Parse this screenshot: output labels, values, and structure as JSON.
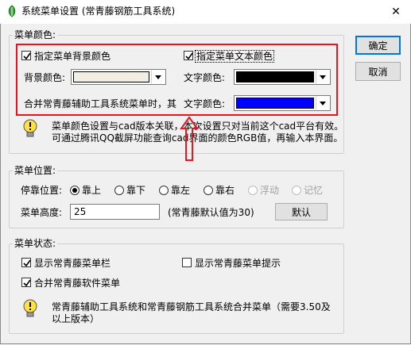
{
  "window": {
    "title": "系统菜单设置 (常青藤钢筋工具系统)",
    "close_glyph": "✕"
  },
  "buttons": {
    "ok": "确定",
    "cancel": "取消",
    "default_value": "默认"
  },
  "menu_color": {
    "legend": "菜单颜色:",
    "bg_checkbox": {
      "label": "指定菜单背景颜色",
      "checked": true
    },
    "text_checkbox": {
      "label": "指定菜单文本颜色",
      "checked": true
    },
    "bg_color_label": "背景颜色:",
    "bg_color_value": "#f2eee4",
    "text_color_label_1": "文字颜色:",
    "text_color_value_1": "#000000",
    "merge_label": "合并常青藤辅助工具系统菜单时，其",
    "text_color_label_2": "文字颜色:",
    "text_color_value_2": "#0000ff",
    "note_line1": "菜单颜色设置与cad版本关联，本次设置只对当前这个cad平台有效。",
    "note_line2": "可通过腾讯QQ截屏功能查询cad界面的颜色RGB值，再输入本界面。"
  },
  "menu_position": {
    "legend": "菜单位置:",
    "dock_label": "停靠位置:",
    "options": [
      {
        "label": "靠上",
        "selected": true,
        "enabled": true
      },
      {
        "label": "靠下",
        "selected": false,
        "enabled": true
      },
      {
        "label": "靠左",
        "selected": false,
        "enabled": true
      },
      {
        "label": "靠右",
        "selected": false,
        "enabled": true
      },
      {
        "label": "浮动",
        "selected": false,
        "enabled": false
      },
      {
        "label": "记忆",
        "selected": false,
        "enabled": false
      }
    ],
    "height_label": "菜单高度:",
    "height_value": "25",
    "height_hint": "(常青藤默认值为30)"
  },
  "menu_state": {
    "legend": "菜单状态:",
    "show_menubar": {
      "label": "显示常青藤菜单栏",
      "checked": true
    },
    "show_menu_tip": {
      "label": "显示常青藤菜单提示",
      "checked": false
    },
    "merge_menu": {
      "label": "合并常青藤软件菜单",
      "checked": true
    },
    "note_line1": "常青藤辅助工具系统和常青藤钢筋工具系统合并菜单（需要3.50及",
    "note_line2": "以上版本）"
  },
  "colors": {
    "annotation_red": "#e8141e",
    "focus_blue": "#0078d7"
  }
}
